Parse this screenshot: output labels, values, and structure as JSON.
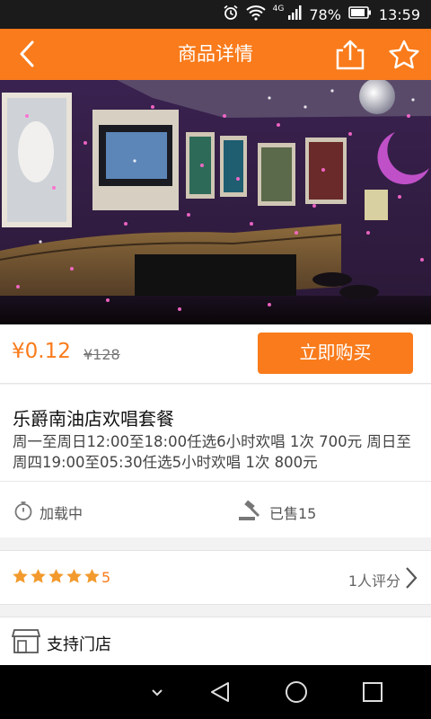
{
  "status_bar": {
    "network": "4G",
    "battery": "78%",
    "time": "13:59",
    "icons": [
      "alarm-icon",
      "wifi-icon",
      "signal-icon",
      "battery-icon"
    ]
  },
  "header": {
    "title": "商品详情",
    "icons": [
      "back-arrow-icon",
      "share-icon",
      "star-icon"
    ]
  },
  "product": {
    "price": "¥0.12",
    "original_price": "¥128",
    "buy_label": "立即购买",
    "name": "乐爵南油店欢唱套餐",
    "description": "周一至周日12:00至18:00任选6小时欢唱 1次 700元 周日至周四19:00至05:30任选5小时欢唱 1次 800元",
    "status": "加载中",
    "sold": "已售15"
  },
  "rating": {
    "stars": 5,
    "score": "5",
    "count": "1人评分"
  },
  "store": {
    "label": "支持门店"
  },
  "colors": {
    "accent": "#f97b1b",
    "star": "#f29a2e"
  }
}
